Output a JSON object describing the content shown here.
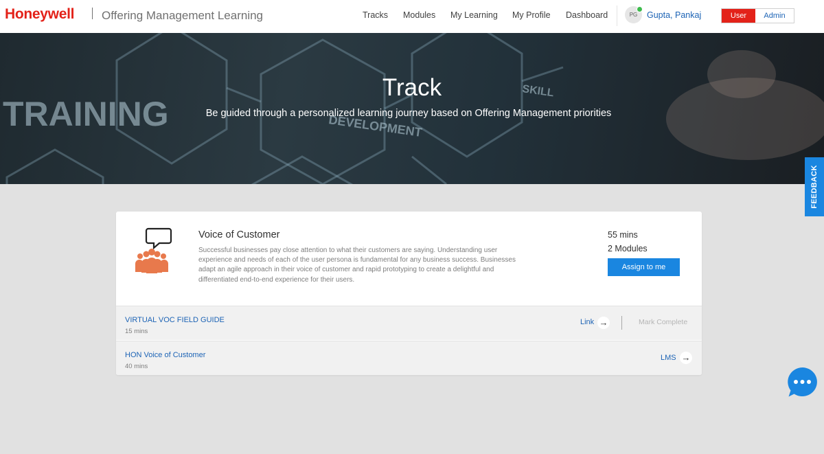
{
  "header": {
    "logo": "Honeywell",
    "app_title": "Offering Management Learning",
    "nav": [
      {
        "label": "Tracks"
      },
      {
        "label": "Modules"
      },
      {
        "label": "My Learning"
      },
      {
        "label": "My Profile"
      },
      {
        "label": "Dashboard"
      }
    ],
    "avatar_initials": "PG",
    "user_name": "Gupta, Pankaj",
    "roles": {
      "user": "User",
      "admin": "Admin"
    }
  },
  "hero": {
    "title": "Track",
    "subtitle": "Be guided through a personalized learning journey based on Offering Management priorities",
    "background_words": [
      "TRAINING",
      "DEVELOPMENT",
      "SKILL"
    ]
  },
  "feedback_tab": "FEEDBACK",
  "track": {
    "title": "Voice of Customer",
    "description": "Successful businesses pay close attention to what their customers are saying. Understanding user experience and needs of each of the user persona is fundamental for any business success. Businesses adapt an agile approach in their voice of customer and rapid prototyping to create a delightful and differentiated end-to-end experience for their users.",
    "duration": "55 mins",
    "modules_count": "2 Modules",
    "assign_label": "Assign to me",
    "icon": "customer-group-speech-icon",
    "modules": [
      {
        "title": "VIRTUAL VOC FIELD GUIDE",
        "duration": "15 mins",
        "link_label": "Link",
        "mark_complete": "Mark Complete"
      },
      {
        "title": "HON Voice of Customer",
        "duration": "40 mins",
        "link_label": "LMS"
      }
    ]
  },
  "colors": {
    "brand_red": "#e32219",
    "primary_blue": "#1a86e0",
    "link_blue": "#1c63b5",
    "icon_orange": "#e8794c"
  },
  "chat_icon": "chat-bubble-icon"
}
